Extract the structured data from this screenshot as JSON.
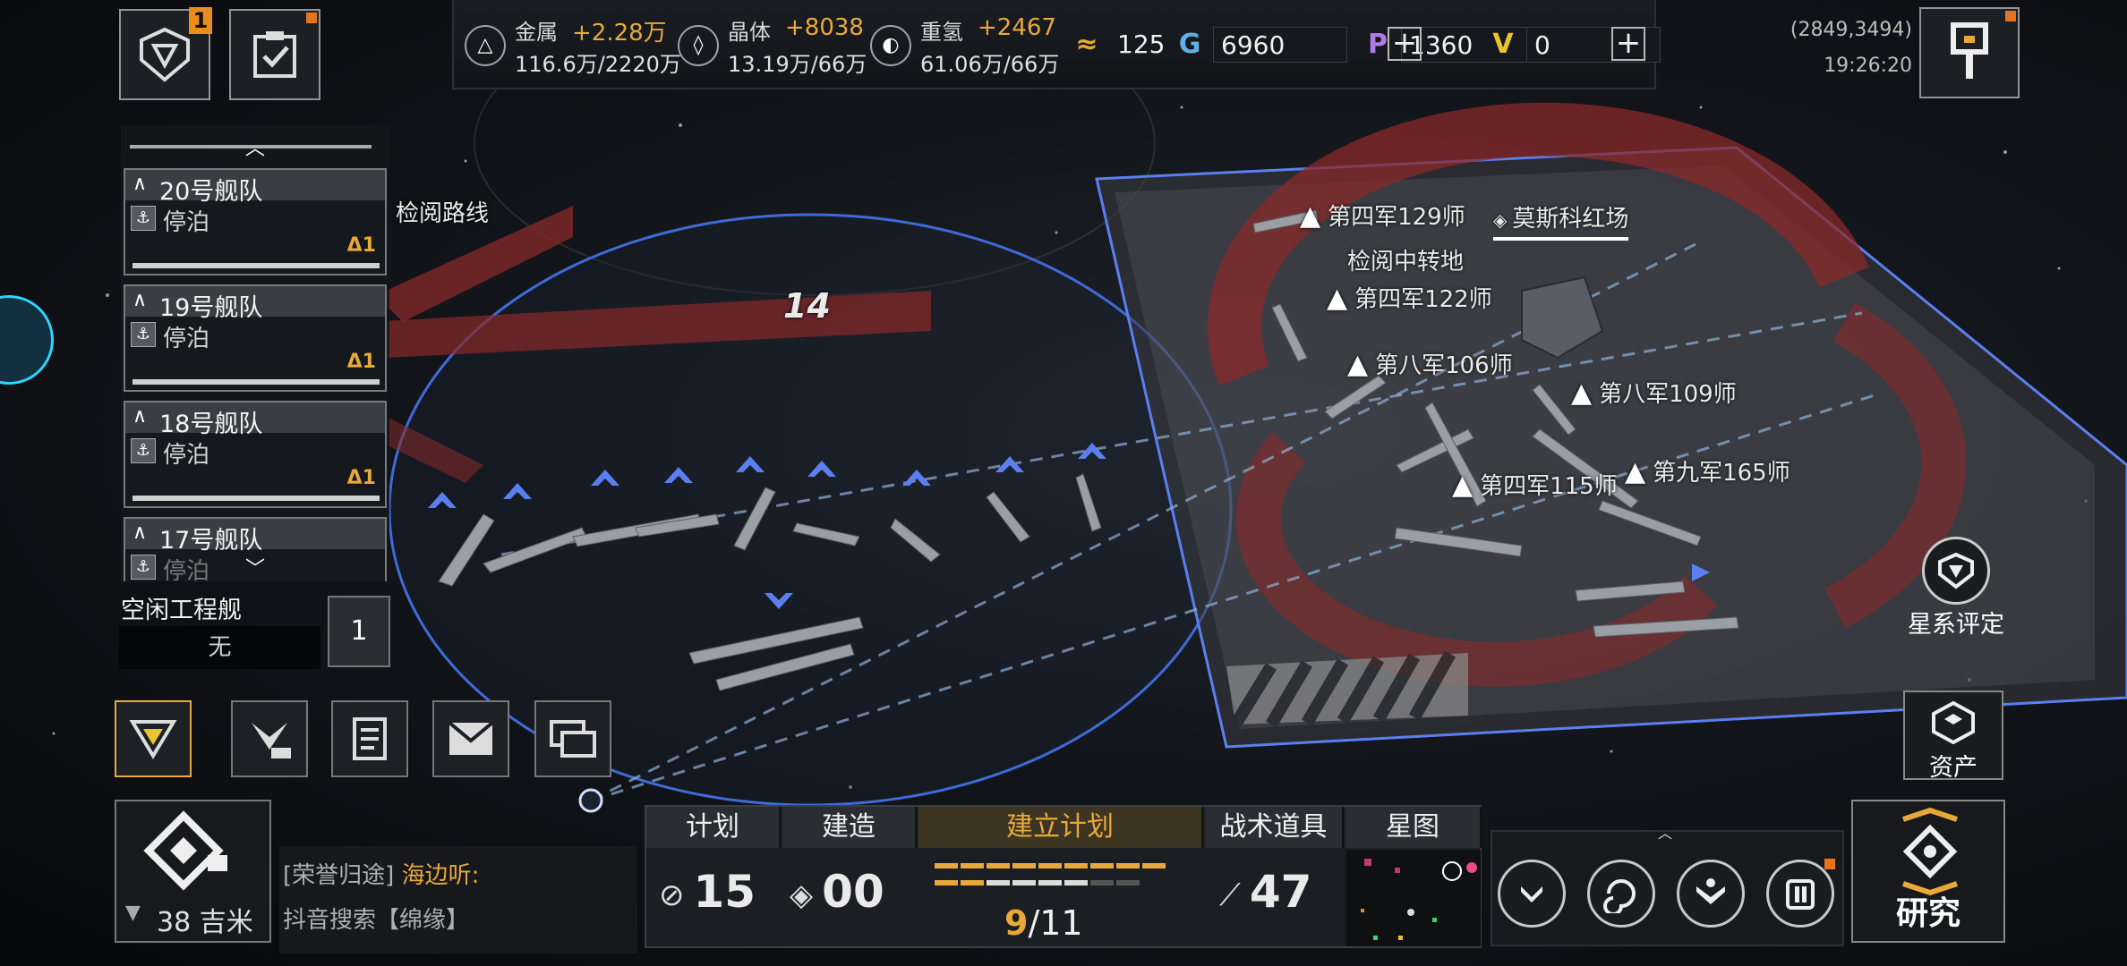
{
  "resources": [
    {
      "name": "金属",
      "gain": "+2.28万",
      "amount": "116.6万/2220万",
      "icon": "metal-icon"
    },
    {
      "name": "晶体",
      "gain": "+8038",
      "amount": "13.19万/66万",
      "icon": "crystal-icon"
    },
    {
      "name": "重氢",
      "gain": "+2467",
      "amount": "61.06万/66万",
      "icon": "deuterium-icon"
    }
  ],
  "currencies": {
    "energy": "125",
    "g_coin": "6960",
    "p_coin": "1360",
    "v_coin": "0"
  },
  "top_left": {
    "alliance_badge": "1"
  },
  "coords": {
    "position": "(2849,3494)",
    "time": "19:26:20"
  },
  "fleets": [
    {
      "name": "20号舰队",
      "status": "停泊",
      "level": "Δ1"
    },
    {
      "name": "19号舰队",
      "status": "停泊",
      "level": "Δ1"
    },
    {
      "name": "18号舰队",
      "status": "停泊",
      "level": "Δ1"
    },
    {
      "name": "17号舰队",
      "status": "停泊"
    }
  ],
  "engineer": {
    "label": "空闲工程舰",
    "value": "无",
    "hex_label": "1"
  },
  "map": {
    "route_label": "检阅路线",
    "sector_number": "14",
    "station_label": "检阅中转地",
    "location_name": "莫斯科红场",
    "divisions": [
      "第四军129师",
      "第四军122师",
      "第八军106师",
      "第八军109师",
      "第四军115师",
      "第九军165师"
    ]
  },
  "bottom": {
    "distance": "38 吉米",
    "chat_channel": "[荣誉归途]",
    "chat_sender": "海边听:",
    "chat_message": "抖音搜索【绵缘】",
    "tabs": [
      "计划",
      "建造",
      "建立计划",
      "战术道具",
      "星图"
    ],
    "plan_value": "15",
    "build_value": "00",
    "build_plan_current": "9",
    "build_plan_total": "/11",
    "tactical_value": "47",
    "research_label": "研究"
  },
  "side": {
    "rating_label": "星系评定",
    "assets_label": "资产"
  },
  "colors": {
    "accent": "#e8a93a",
    "fleet_blue": "#5b7ff0",
    "danger_red": "#8a2a2a",
    "sphere_blue": "#3f6bd8"
  }
}
